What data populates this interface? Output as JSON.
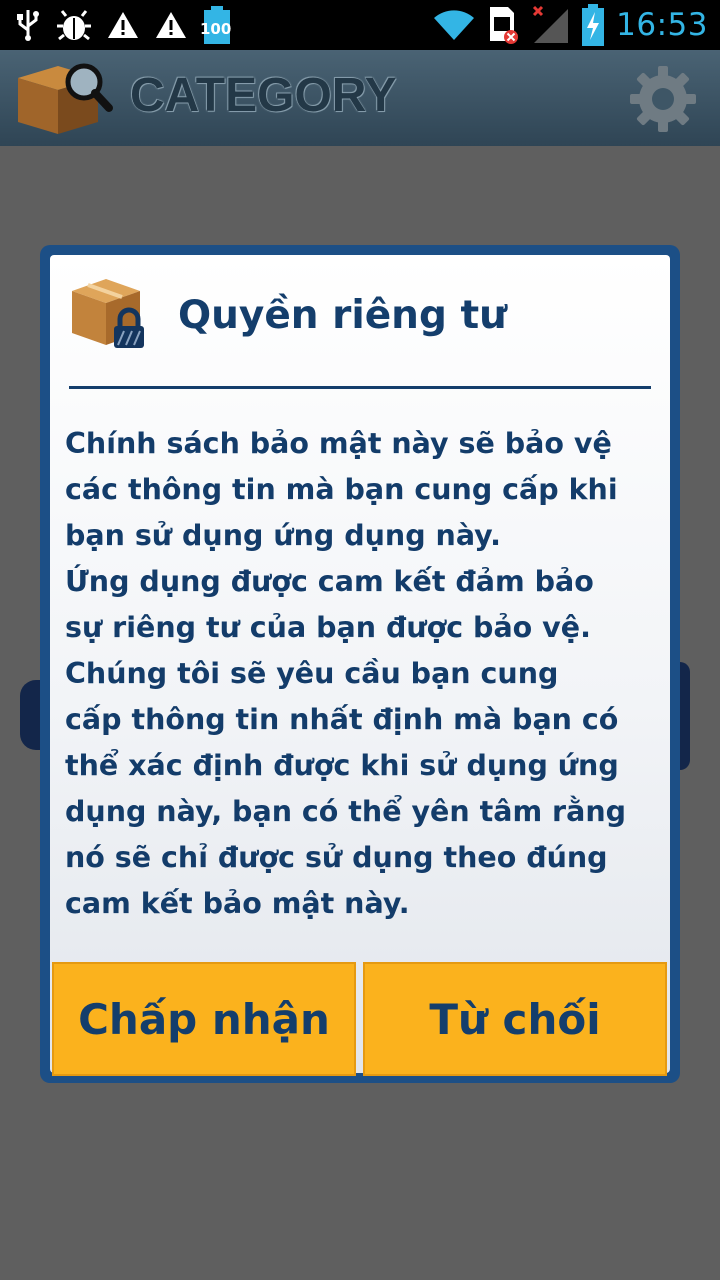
{
  "status_bar": {
    "time": "16:53",
    "battery_badge": "100",
    "left_icons": [
      "usb-icon",
      "debug-bug-icon",
      "warning-icon",
      "warning-icon",
      "battery-100-icon"
    ],
    "right_icons": [
      "wifi-icon",
      "sim-error-icon",
      "signal-no-service-icon",
      "battery-charging-icon"
    ]
  },
  "app_bar": {
    "title": "CATEGORY",
    "logo_icon": "box-search-icon",
    "settings_icon": "gear-icon"
  },
  "dialog": {
    "title": "Quyền riêng tư",
    "icon": "box-lock-icon",
    "body": "Chính sách bảo mật này sẽ bảo vệ\ncác thông tin mà bạn cung cấp khi\nbạn sử dụng ứng dụng này.\n Ứng dụng được cam kết đảm bảo\nsự riêng tư của bạn được bảo vệ.\nChúng tôi sẽ yêu cầu bạn cung\ncấp thông tin nhất định mà bạn có\nthể xác định được khi sử dụng ứng\ndụng này, bạn có thể yên tâm rằng\nnó sẽ chỉ được sử dụng theo đúng\ncam kết bảo mật này.",
    "accept_label": "Chấp nhận",
    "decline_label": "Từ chối"
  },
  "colors": {
    "accent_blue": "#143e6c",
    "button_orange": "#fbb21d",
    "clock_blue": "#33b5e5"
  }
}
